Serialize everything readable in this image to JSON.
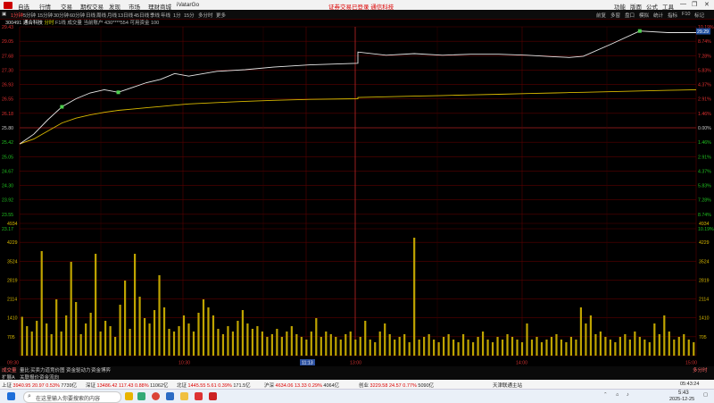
{
  "menubar": {
    "items": [
      "自选",
      "行情",
      "交易",
      "期权交易",
      "发现",
      "市场",
      "理财商城",
      "iVatarGo"
    ],
    "center_text": "证券交易已登录 通信科技",
    "right_items": [
      "功能",
      "版面",
      "公式",
      "工具"
    ],
    "window_controls": [
      "—",
      "❐",
      "✕"
    ]
  },
  "tabbar": {
    "tabs": [
      "1分钟",
      "5分钟",
      "15分钟",
      "30分钟",
      "60分钟",
      "日线",
      "周线",
      "月线",
      "13日线",
      "45日线",
      "季线",
      "年线",
      "1分",
      "15分",
      "多分时",
      "更多"
    ],
    "active_index": 0,
    "right_items": [
      "前复",
      "多窗",
      "盘口",
      "模拟",
      "统计",
      "指标",
      "F10",
      "标记"
    ]
  },
  "stock": {
    "code": "300491",
    "name": "通合科技",
    "mode": "分时",
    "indicator": "F1线 成交量",
    "account": "当前账户 430****554",
    "buyable": "可用资金 100"
  },
  "chart_data": {
    "type": "line",
    "time_labels": [
      "09:30",
      "10:30",
      "11:13",
      "13:00",
      "14:00",
      "15:00"
    ],
    "price_ticks_left": [
      "29.43",
      "29.05",
      "27.68",
      "27.30",
      "26.93",
      "26.55",
      "26.18",
      "25.80",
      "25.42",
      "25.05",
      "24.67",
      "24.30",
      "23.92",
      "23.55",
      "23.17"
    ],
    "price_ticks_right": [
      "10.19%",
      "8.74%",
      "7.28%",
      "5.83%",
      "4.37%",
      "2.91%",
      "1.46%",
      "0.00%",
      "1.46%",
      "2.91%",
      "4.37%",
      "5.83%",
      "7.28%",
      "8.74%",
      "10.19%"
    ],
    "pre_close": 25.8,
    "current_price_label": "29.29",
    "volume_ticks": [
      "4934",
      "4229",
      "3524",
      "2819",
      "2114",
      "1410",
      "705"
    ],
    "xlabel": "",
    "ylabel": "",
    "price_series": {
      "name": "",
      "x": [
        "09:30",
        "09:35",
        "09:40",
        "09:45",
        "09:50",
        "09:55",
        "10:00",
        "10:05",
        "10:10",
        "10:15",
        "10:20",
        "10:25",
        "10:30",
        "10:40",
        "10:50",
        "11:00",
        "11:13",
        "11:30",
        "13:00",
        "13:10",
        "13:20",
        "13:30",
        "13:40",
        "13:50",
        "14:00",
        "14:10",
        "14:15",
        "14:20",
        "14:30",
        "14:40",
        "14:50",
        "15:00"
      ],
      "values": [
        25.8,
        26.1,
        26.55,
        26.95,
        27.2,
        27.38,
        27.48,
        27.4,
        27.55,
        27.7,
        27.8,
        27.98,
        27.9,
        28.05,
        28.1,
        28.18,
        28.25,
        28.3,
        28.65,
        28.55,
        28.6,
        28.55,
        28.58,
        28.58,
        28.55,
        28.5,
        28.48,
        28.52,
        28.9,
        29.3,
        29.25,
        29.25
      ]
    },
    "avg_series": {
      "name": "",
      "values": [
        25.8,
        25.95,
        26.2,
        26.45,
        26.6,
        26.7,
        26.78,
        26.84,
        26.88,
        26.92,
        26.96,
        27.0,
        27.04,
        27.08,
        27.12,
        27.15,
        27.18,
        27.2,
        27.24,
        27.26,
        27.28,
        27.3,
        27.32,
        27.34,
        27.36,
        27.38,
        27.39,
        27.4,
        27.42,
        27.44,
        27.46,
        27.48
      ]
    },
    "volume": [
      1450,
      1100,
      900,
      1300,
      3900,
      1200,
      800,
      2100,
      900,
      1500,
      3500,
      2000,
      800,
      1200,
      1600,
      3800,
      900,
      1300,
      1100,
      700,
      1900,
      2800,
      1000,
      3800,
      2200,
      1400,
      1200,
      1700,
      3000,
      1800,
      1000,
      900,
      1100,
      1500,
      1200,
      900,
      1600,
      2100,
      1800,
      1500,
      1000,
      800,
      1100,
      900,
      1300,
      1700,
      1200,
      1000,
      1100,
      900,
      700,
      800,
      1000,
      700,
      900,
      1100,
      800,
      700,
      600,
      900,
      1400,
      700,
      900,
      800,
      700,
      600,
      800,
      900,
      600,
      700,
      1300,
      600,
      500,
      900,
      1200,
      800,
      600,
      700,
      800,
      500,
      4400,
      600,
      700,
      800,
      600,
      500,
      700,
      800,
      600,
      500,
      800,
      600,
      500,
      700,
      900,
      600,
      500,
      700,
      600,
      800,
      700,
      600,
      500,
      1200,
      600,
      700,
      500,
      600,
      700,
      800,
      600,
      500,
      700,
      600,
      1800,
      1200,
      1500,
      800,
      900,
      700,
      600,
      500,
      700,
      800,
      600,
      900,
      700,
      600,
      500,
      1200,
      800,
      1500,
      900,
      600,
      700,
      800,
      600,
      500
    ]
  },
  "bottombar": {
    "tabs": [
      "成交量",
      "量比",
      "买卖力道",
      "竞价图",
      "资金驱动力",
      "资金博弈"
    ],
    "tabs2": [
      "扩展A",
      "关联报价",
      "资金流向"
    ],
    "right_label": "多分时"
  },
  "indexbar": {
    "sh": {
      "name": "上证",
      "val": "3940.95",
      "chg": "20.97",
      "pct": "0.53%",
      "amt": "7739亿"
    },
    "sz": {
      "name": "深证",
      "val": "13486.42",
      "chg": "117.43",
      "pct": "0.88%",
      "amt": "11062亿"
    },
    "bj": {
      "name": "北证",
      "val": "1445.55",
      "chg": "5.61",
      "pct": "0.39%",
      "amt": "171.5亿"
    },
    "hs300": {
      "name": "沪深",
      "val": "4634.06",
      "chg": "13.33",
      "pct": "0.29%",
      "amt": "4064亿"
    },
    "cyb": {
      "name": "创业",
      "val": "3229.58",
      "chg": "24.57",
      "pct": "0.77%",
      "amt": "5090亿"
    },
    "node": "天津联通主站",
    "time": "05:43:24"
  },
  "taskbar": {
    "search_placeholder": "在这里输入你要搜索的内容",
    "clock_time": "5:43",
    "clock_date": "2025-12-25"
  }
}
